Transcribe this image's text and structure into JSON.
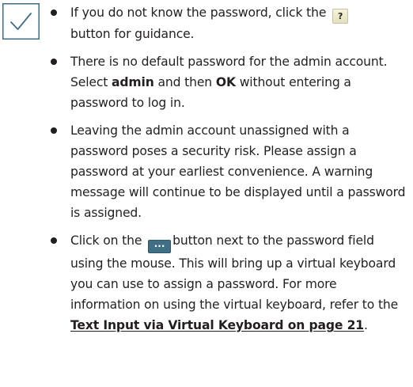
{
  "note": {
    "icon": "checkmark-icon",
    "icon_color": "#3f6e85",
    "border_color": "#3f6e85"
  },
  "bullets": [
    {
      "text_before_button": "If you do not know the password, click the ",
      "button_label": "?",
      "text_after_button": "button for guidance."
    },
    {
      "text_1": "There is no default password for the admin account. Select ",
      "bold_1": "admin",
      "text_2": " and then ",
      "bold_2": "OK",
      "text_3": " without entering a password to log in."
    },
    {
      "text": "Leaving the admin account unassigned with a password poses a security risk. Please assign a password at your earliest convenience. A warning message will continue to be displayed until a password is assigned."
    },
    {
      "text_before_button": "Click on the ",
      "button_label": "...",
      "text_after_button": "button next to the password field using the mouse. This will bring up a virtual keyboard you can use to assign a password. For more information on using the virtual keyboard, refer to the ",
      "link_text": "Text Input via Virtual Keyboard on page 21",
      "text_end": "."
    }
  ]
}
